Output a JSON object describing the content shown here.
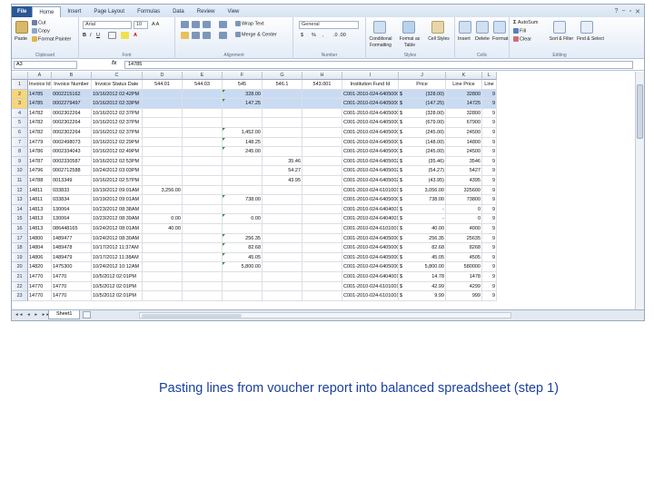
{
  "ribbon": {
    "tabs": [
      "File",
      "Home",
      "Insert",
      "Page Layout",
      "Formulas",
      "Data",
      "Review",
      "View"
    ],
    "clipboard": {
      "paste": "Paste",
      "cut": "Cut",
      "copy": "Copy",
      "format_painter": "Format Painter",
      "label": "Clipboard"
    },
    "font": {
      "name": "Arial",
      "size": "10",
      "label": "Font"
    },
    "alignment": {
      "wrap": "Wrap Text",
      "merge": "Merge & Center",
      "label": "Alignment"
    },
    "number": {
      "format": "General",
      "currency": "$",
      "percent": "%",
      "comma": ",",
      "label": "Number"
    },
    "styles": {
      "conditional": "Conditional Formatting",
      "format_table": "Format as Table",
      "cell_styles": "Cell Styles",
      "label": "Styles"
    },
    "cells": {
      "insert": "Insert",
      "delete": "Delete",
      "format": "Format",
      "label": "Cells"
    },
    "editing": {
      "autosum": "AutoSum",
      "fill": "Fill",
      "clear": "Clear",
      "sort": "Sort & Filter",
      "find": "Find & Select",
      "label": "Editing"
    }
  },
  "formula_bar": {
    "name_box": "A3",
    "fx": "fx",
    "content": "14785"
  },
  "grid": {
    "col_letters": [
      "A",
      "B",
      "C",
      "D",
      "E",
      "F",
      "G",
      "H",
      "I",
      "J",
      "K",
      "L"
    ],
    "row_numbers": [
      "1",
      "2",
      "3",
      "4",
      "5",
      "6",
      "7",
      "8",
      "9",
      "10",
      "11",
      "12",
      "13",
      "14",
      "15",
      "16",
      "17",
      "18",
      "19",
      "20",
      "21",
      "22",
      "23"
    ],
    "header_row": [
      "Invoice Id",
      "Invoice Number",
      "Invoice Status Date",
      "544.01",
      "544.03",
      "545",
      "546.1",
      "543.001",
      "Institution Fund Id",
      "Price",
      "Line Price",
      "Line"
    ],
    "rows": [
      [
        "14785",
        "0002215162",
        "10/16/2012 02:42PM",
        "",
        "",
        "328.00",
        "",
        "",
        "C001-2010-024-6405000",
        "$",
        "(328.00)",
        "32800",
        "9"
      ],
      [
        "14785",
        "0002279497",
        "10/16/2012 02:33PM",
        "",
        "",
        "147.25",
        "",
        "",
        "C001-2010-024-6405000",
        "$",
        "(147.25)",
        "14725",
        "9"
      ],
      [
        "14782",
        "0002302264",
        "10/16/2012 02:37PM",
        "",
        "",
        "",
        "",
        "",
        "C001-2010-024-6405000",
        "$",
        "(328.00)",
        "32800",
        "9"
      ],
      [
        "14782",
        "0002302264",
        "10/16/2012 02:37PM",
        "",
        "",
        "",
        "",
        "",
        "C001-2010-024-6405000",
        "$",
        "(679.00)",
        "67900",
        "9"
      ],
      [
        "14782",
        "0002302264",
        "10/16/2012 02:37PM",
        "",
        "",
        "1,452.00",
        "",
        "",
        "C001-2010-024-6405000",
        "$",
        "(245.00)",
        "24500",
        "9"
      ],
      [
        "14779",
        "0002498073",
        "10/16/2012 02:29PM",
        "",
        "",
        "148.25",
        "",
        "",
        "C001-2010-024-6405000",
        "$",
        "(148.00)",
        "14800",
        "9"
      ],
      [
        "14786",
        "0002334043",
        "10/16/2012 02:49PM",
        "",
        "",
        "245.00",
        "",
        "",
        "C001-2010-024-6405000",
        "$",
        "(245.00)",
        "24500",
        "9"
      ],
      [
        "14787",
        "0002330587",
        "10/16/2012 02:53PM",
        "",
        "",
        "",
        "35.46",
        "",
        "C001-2010-024-6405002",
        "$",
        "(35.46)",
        "3546",
        "9"
      ],
      [
        "14796",
        "0002712588",
        "10/24/2012 03:03PM",
        "",
        "",
        "",
        "54.27",
        "",
        "C001-2010-024-6405002",
        "$",
        "(54.27)",
        "5427",
        "9"
      ],
      [
        "14788",
        "0013349",
        "10/16/2012 02:57PM",
        "",
        "",
        "",
        "43.95",
        "",
        "C001-2010-024-6405002",
        "$",
        "(43.95)",
        "4395",
        "9"
      ],
      [
        "14811",
        "033833",
        "10/19/2012 09:01AM",
        "3,256.00",
        "",
        "",
        "",
        "",
        "C001-2010-024-6101001",
        "$",
        "3,056.00",
        "325600",
        "9"
      ],
      [
        "14811",
        "033834",
        "10/19/2012 09:01AM",
        "",
        "",
        "738.00",
        "",
        "",
        "C001-2010-024-6405000",
        "$",
        "738.00",
        "73800",
        "9"
      ],
      [
        "14813",
        "130064",
        "10/23/2012 08:38AM",
        "",
        "",
        "",
        "",
        "",
        "C001-2010-024-6404001",
        "$",
        "-",
        "0",
        "9"
      ],
      [
        "14813",
        "130064",
        "10/23/2012 08:39AM",
        "0.00",
        "",
        "0.00",
        "",
        "",
        "C001-2010-024-6404001",
        "$",
        "-",
        "0",
        "9"
      ],
      [
        "14813",
        "086448165",
        "10/24/2012 08:01AM",
        "40.00",
        "",
        "",
        "",
        "",
        "C001-2010-024-6101001",
        "$",
        "40.00",
        "4000",
        "9"
      ],
      [
        "14800",
        "1489477",
        "10/24/2012 08:30AM",
        "",
        "",
        "256.35",
        "",
        "",
        "C001-2010-024-6405000",
        "$",
        "256.35",
        "25635",
        "9"
      ],
      [
        "14804",
        "1489478",
        "10/17/2012 11:37AM",
        "",
        "",
        "82.68",
        "",
        "",
        "C001-2010-024-6405000",
        "$",
        "82.68",
        "8268",
        "9"
      ],
      [
        "14806",
        "1489479",
        "10/17/2012 11:38AM",
        "",
        "",
        "45.05",
        "",
        "",
        "C001-2010-024-6405000",
        "$",
        "45.05",
        "4505",
        "9"
      ],
      [
        "14820",
        "1475300",
        "10/24/2012 10:12AM",
        "",
        "",
        "5,800.00",
        "",
        "",
        "C001-2010-024-6405000",
        "$",
        "5,800.00",
        "580000",
        "9"
      ],
      [
        "14770",
        "14770",
        "10/5/2012 02:01PM",
        "",
        "",
        "",
        "",
        "",
        "C001-2010-024-6404001",
        "$",
        "14.78",
        "1478",
        "9"
      ],
      [
        "14770",
        "14770",
        "10/5/2012 02:01PM",
        "",
        "",
        "",
        "",
        "",
        "C001-2010-024-6101001",
        "$",
        "42.99",
        "4299",
        "9"
      ],
      [
        "14770",
        "14770",
        "10/5/2012 02:01PM",
        "",
        "",
        "",
        "",
        "",
        "C001-2010-024-6101001",
        "$",
        "9.99",
        "999",
        "9"
      ]
    ]
  },
  "sheet_tab": "Sheet1",
  "caption": "Pasting lines from voucher report into balanced spreadsheet (step 1)"
}
